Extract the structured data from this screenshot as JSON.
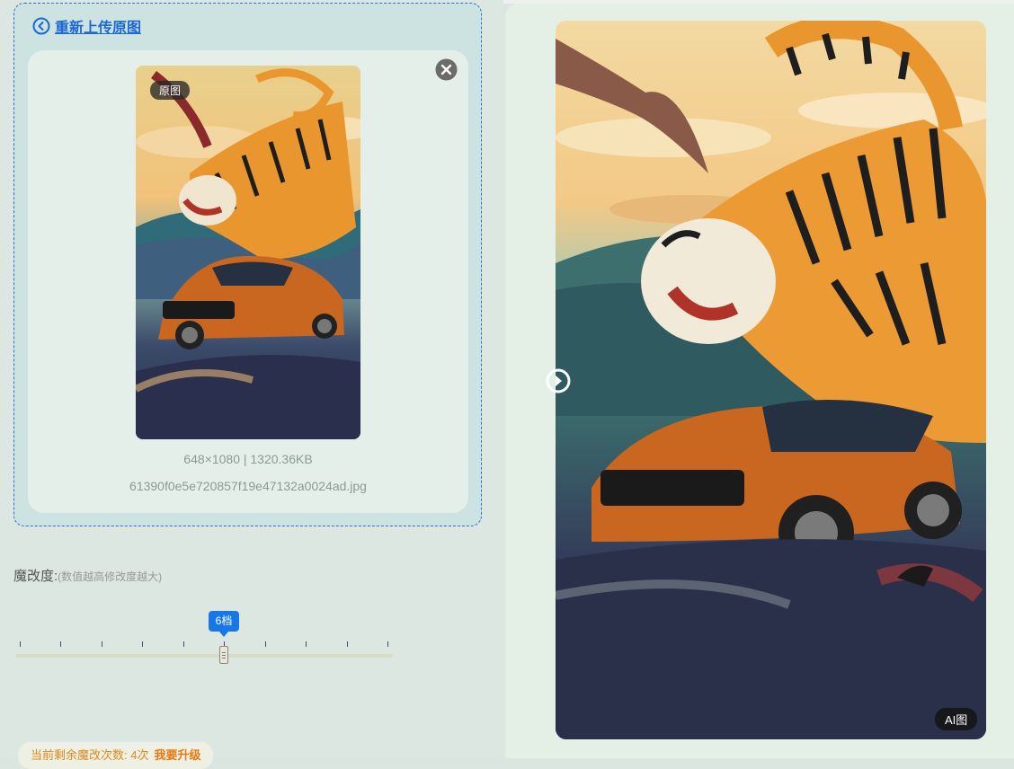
{
  "header": {
    "reupload_label": "重新上传原图"
  },
  "original": {
    "badge": "原图",
    "dimensions_size": "648×1080 | 1320.36KB",
    "filename": "61390f0e5e720857f19e47132a0024ad.jpg"
  },
  "degree": {
    "label": "魔改度:",
    "hint": "(数值越高修改度越大)",
    "value_label": "6档",
    "value": 6,
    "max_ticks": 10
  },
  "remaining": {
    "text": "当前剩余魔改次数: 4次",
    "upgrade_label": "我要升级"
  },
  "result": {
    "badge": "AI图"
  },
  "colors": {
    "accent": "#1877e6",
    "link": "#1a67d6",
    "warning": "#d98a1f"
  },
  "icons": [
    "back-circle-icon",
    "close-circle-icon",
    "compare-slider-icon"
  ]
}
